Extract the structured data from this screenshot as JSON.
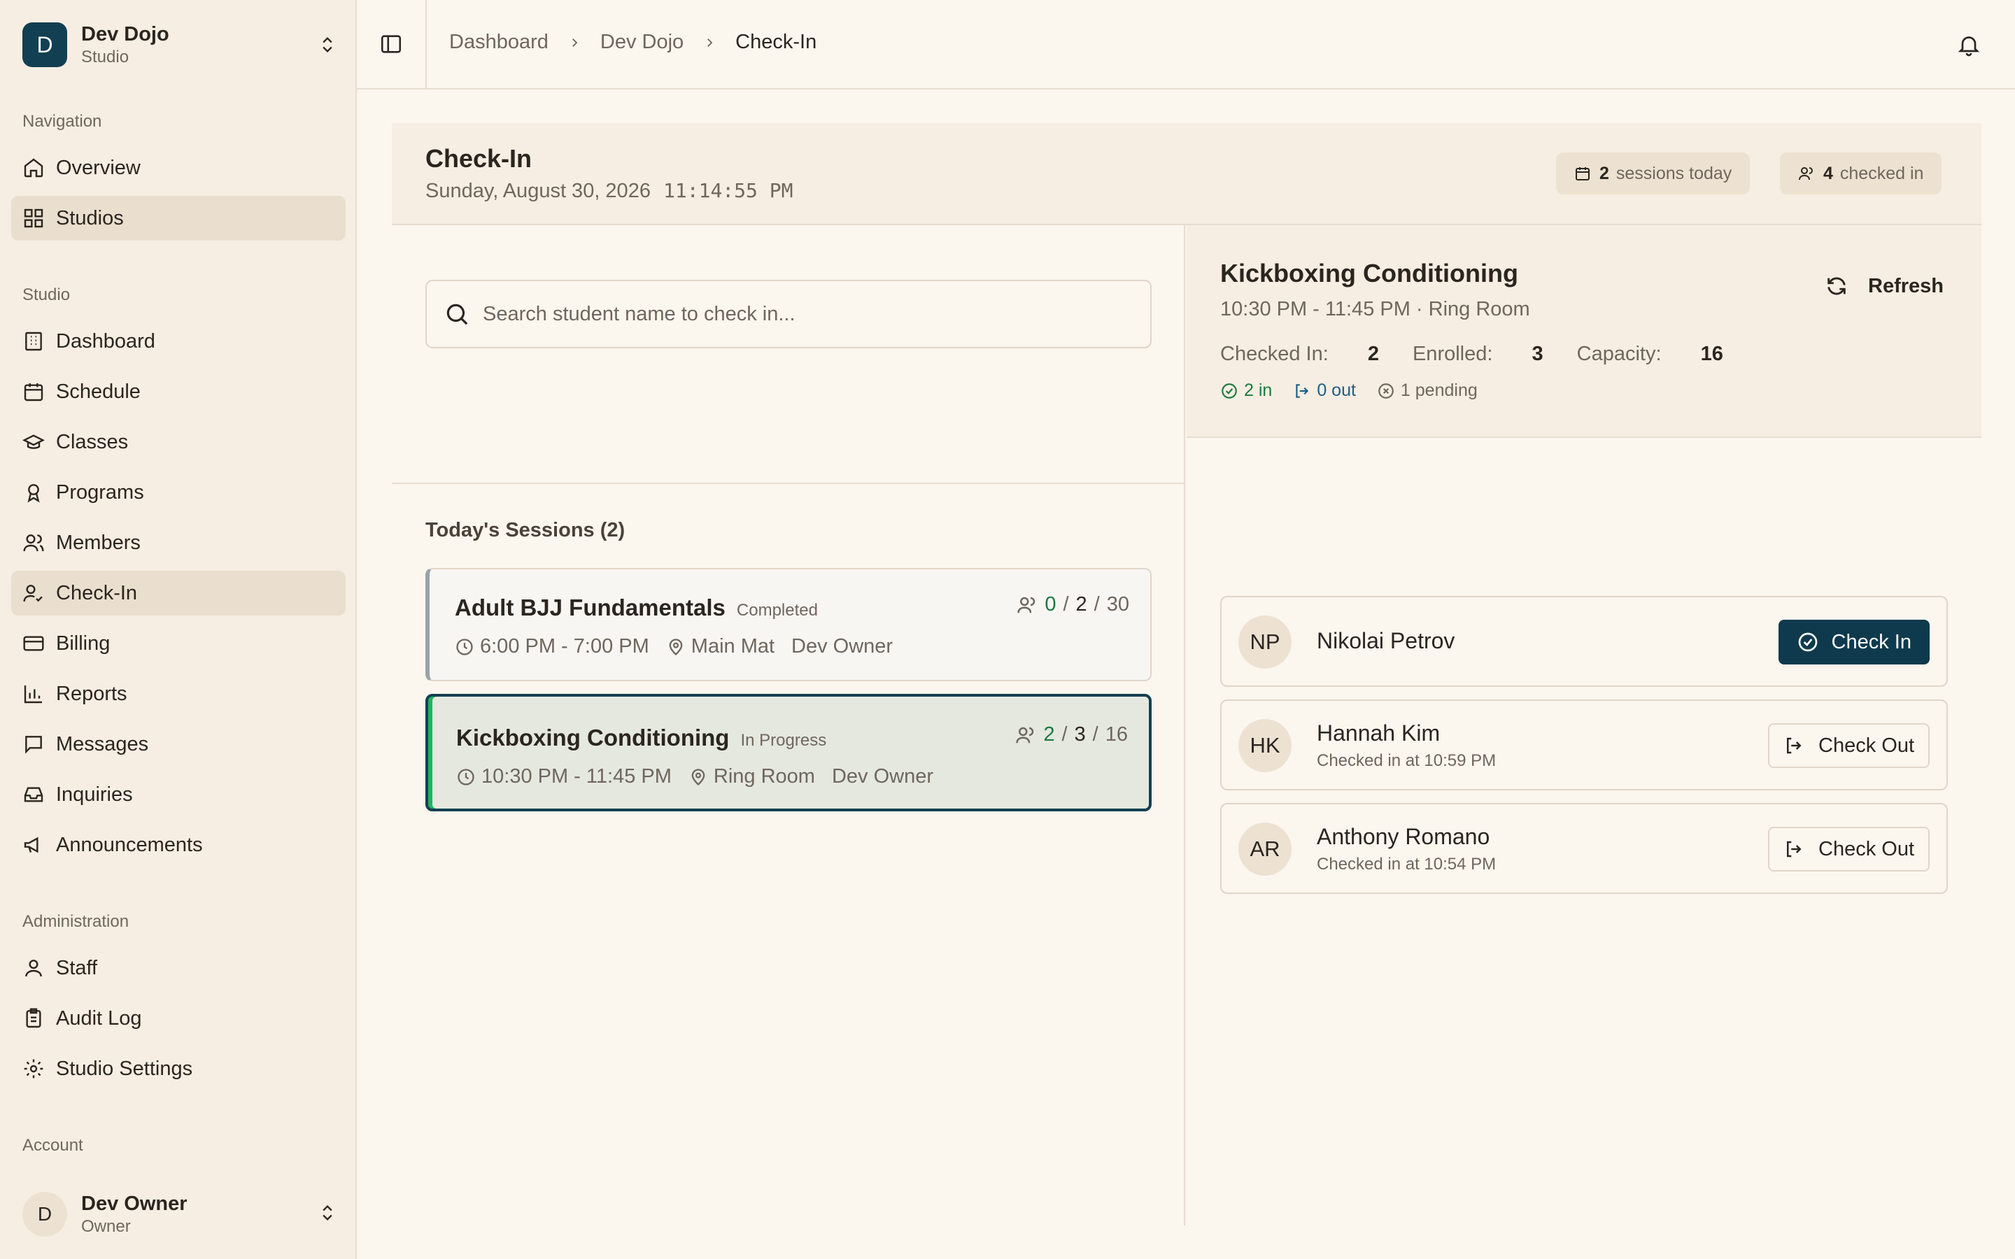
{
  "org": {
    "initial": "D",
    "name": "Dev Dojo",
    "subtitle": "Studio"
  },
  "sidebar": {
    "navigation_label": "Navigation",
    "navigation": [
      {
        "label": "Overview",
        "icon": "home-icon"
      },
      {
        "label": "Studios",
        "icon": "grid-icon"
      }
    ],
    "studio_label": "Studio",
    "studio": [
      {
        "label": "Dashboard",
        "icon": "building-icon"
      },
      {
        "label": "Schedule",
        "icon": "calendar-icon"
      },
      {
        "label": "Classes",
        "icon": "graduation-cap-icon"
      },
      {
        "label": "Programs",
        "icon": "ribbon-icon"
      },
      {
        "label": "Members",
        "icon": "users-icon"
      },
      {
        "label": "Check-In",
        "icon": "user-check-icon"
      },
      {
        "label": "Billing",
        "icon": "credit-card-icon"
      },
      {
        "label": "Reports",
        "icon": "bar-chart-icon"
      },
      {
        "label": "Messages",
        "icon": "message-icon"
      },
      {
        "label": "Inquiries",
        "icon": "inbox-icon"
      },
      {
        "label": "Announcements",
        "icon": "megaphone-icon"
      }
    ],
    "admin_label": "Administration",
    "administration": [
      {
        "label": "Staff",
        "icon": "user-icon"
      },
      {
        "label": "Audit Log",
        "icon": "clipboard-icon"
      },
      {
        "label": "Studio Settings",
        "icon": "gear-icon"
      }
    ],
    "account_label": "Account",
    "account": {
      "initial": "D",
      "name": "Dev Owner",
      "role": "Owner"
    }
  },
  "breadcrumb": [
    "Dashboard",
    "Dev Dojo",
    "Check-In"
  ],
  "page": {
    "title": "Check-In",
    "date": "Sunday, August 30, 2026",
    "time": "11:14:55 PM",
    "sessions_today_count": "2",
    "sessions_today_label": "sessions today",
    "checked_in_count": "4",
    "checked_in_label": "checked in"
  },
  "search": {
    "placeholder": "Search student name to check in..."
  },
  "sessions": {
    "title": "Today's Sessions (2)",
    "items": [
      {
        "name": "Adult BJJ Fundamentals",
        "status": "Completed",
        "time": "6:00 PM - 7:00 PM",
        "location": "Main Mat",
        "instructor": "Dev Owner",
        "checked_in": "0",
        "enrolled": "2",
        "capacity": "30"
      },
      {
        "name": "Kickboxing Conditioning",
        "status": "In Progress",
        "time": "10:30 PM - 11:45 PM",
        "location": "Ring Room",
        "instructor": "Dev Owner",
        "checked_in": "2",
        "enrolled": "3",
        "capacity": "16"
      }
    ]
  },
  "selected_class": {
    "title": "Kickboxing Conditioning",
    "subtitle": "10:30 PM - 11:45 PM · Ring Room",
    "refresh_label": "Refresh",
    "checked_in_label": "Checked In:",
    "checked_in_value": "2",
    "enrolled_label": "Enrolled:",
    "enrolled_value": "3",
    "capacity_label": "Capacity:",
    "capacity_value": "16",
    "in_text": "2 in",
    "out_text": "0 out",
    "pending_text": "1 pending"
  },
  "roster": [
    {
      "initials": "NP",
      "name": "Nikolai Petrov",
      "sub": "",
      "action": "Check In"
    },
    {
      "initials": "HK",
      "name": "Hannah Kim",
      "sub": "Checked in at 10:59 PM",
      "action": "Check Out"
    },
    {
      "initials": "AR",
      "name": "Anthony Romano",
      "sub": "Checked in at 10:54 PM",
      "action": "Check Out"
    }
  ],
  "colors": {
    "accent": "#133f52",
    "in_progress": "#22b45a",
    "success": "#1c7a3e",
    "info": "#1d5f86"
  }
}
